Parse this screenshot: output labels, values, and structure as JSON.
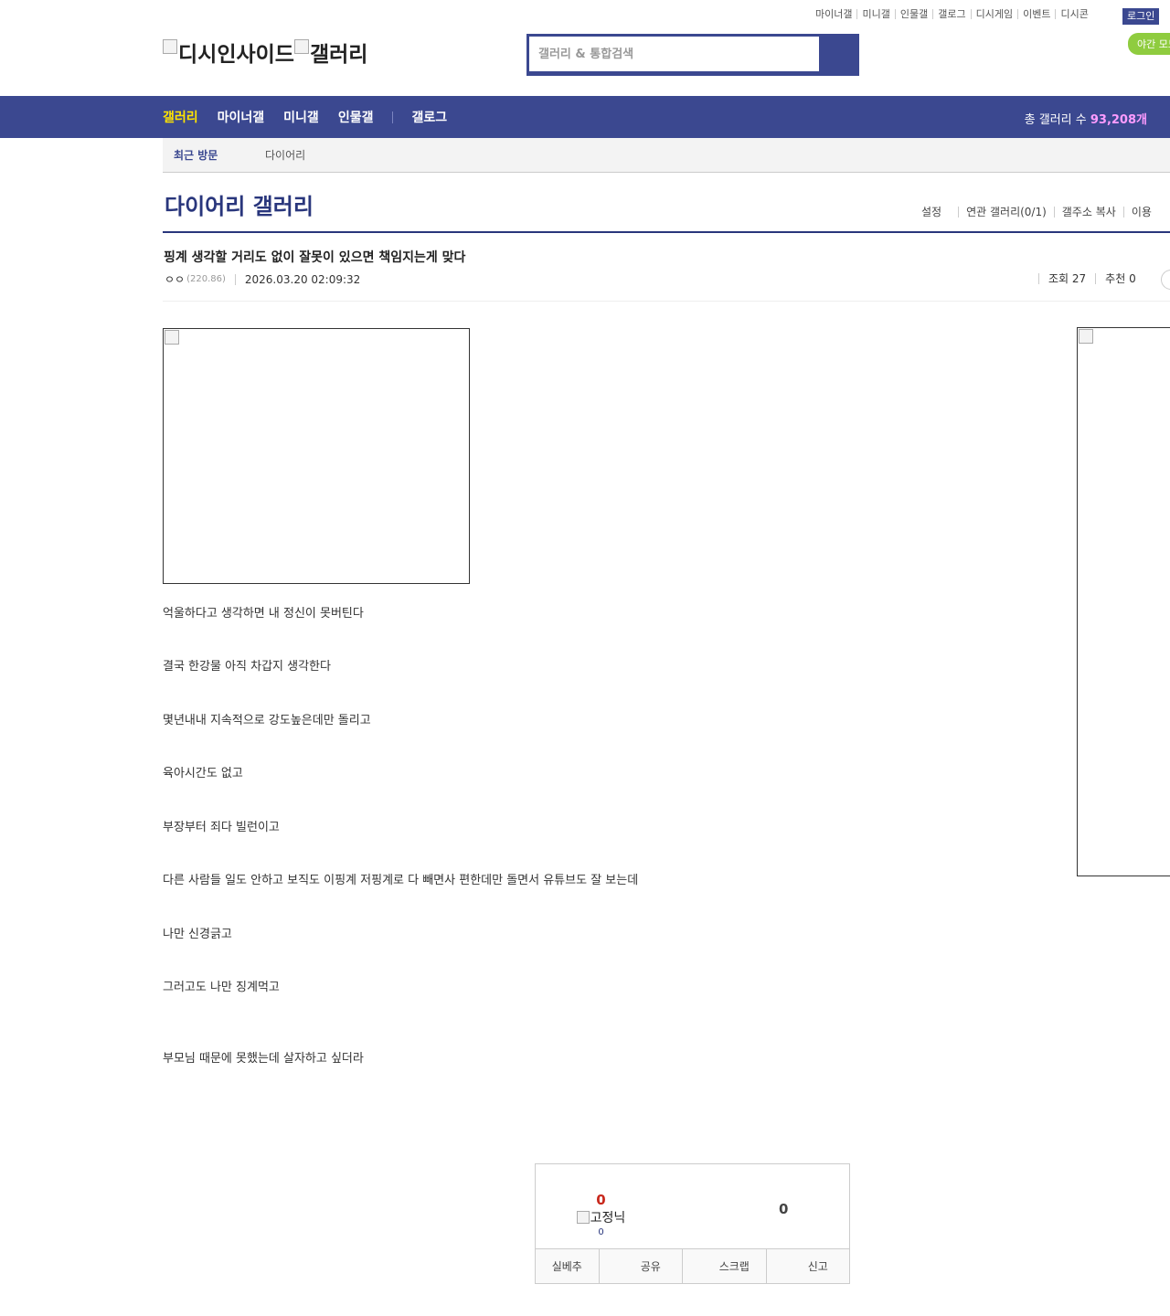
{
  "top_links": [
    "마이너갤",
    "미니갤",
    "인물갤",
    "갤로그",
    "디시게임",
    "이벤트",
    "디시콘"
  ],
  "login_label": "로그인",
  "night_mode_label": "야간 모드",
  "logo": {
    "part1": "디시인사이드",
    "part2": "갤러리"
  },
  "search": {
    "placeholder": "갤러리 & 통합검색"
  },
  "nav": {
    "items": [
      "갤러리",
      "마이너갤",
      "미니갤",
      "인물갤",
      "갤로그"
    ],
    "active": "갤러리"
  },
  "total_galleries": {
    "label": "총 갤러리 수",
    "count": "93,208개"
  },
  "recent": {
    "label": "최근 방문",
    "value": "다이어리"
  },
  "gallery_title": "다이어리 갤러리",
  "gallery_tools": [
    "설정",
    "연관 갤러리(0/1)",
    "갤주소 복사",
    "이용"
  ],
  "post": {
    "title": "핑계 생각할 거리도 없이 잘못이 있으면 책임지는게 맞다",
    "author": "ㅇㅇ",
    "ip": "(220.86)",
    "date": "2026.03.20 02:09:32",
    "views": "조회 27",
    "recommend": "추천 0",
    "lines": [
      "억울하다고 생각하면 내 정신이 못버틴다",
      "결국 한강물 아직 차갑지 생각한다",
      "몇년내내 지속적으로 강도높은데만 돌리고",
      "육아시간도 없고",
      "부장부터 죄다 빌런이고",
      "다른 사람들 일도 안하고 보직도 이핑계 저핑계로 다 빼면사 편한데만 돌면서 유튜브도 잘 보는데",
      "나만 신경긁고",
      "그러고도 나만 징계먹고",
      "부모님 때문에 못했는데 살자하고 싶더라"
    ]
  },
  "recommend_box": {
    "up_count": "0",
    "fixed_label": "고정닉",
    "fixed_count": "0",
    "down_count": "0",
    "buttons": [
      "실베추",
      "공유",
      "스크랩",
      "신고"
    ]
  }
}
